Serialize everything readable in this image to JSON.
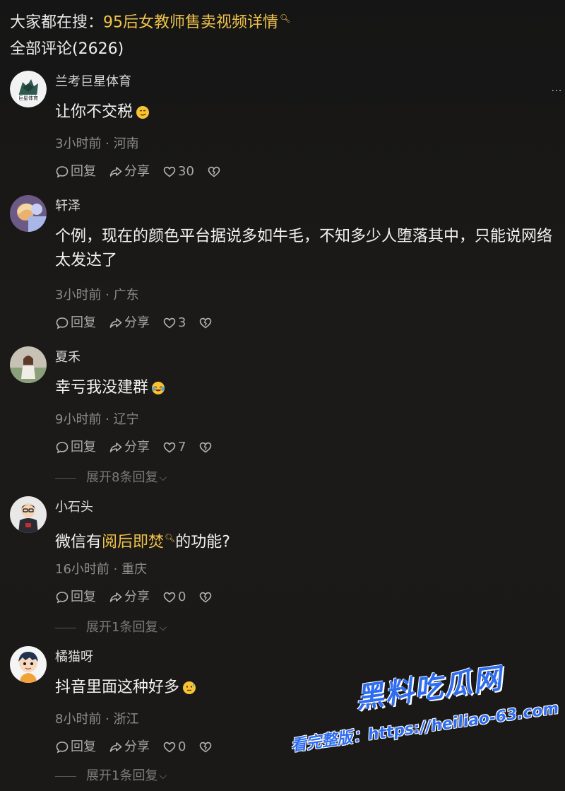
{
  "search": {
    "prefix": "大家都在搜：",
    "link_text": "95后女教师售卖视频详情",
    "icon": "search-icon"
  },
  "comments_header": {
    "label": "全部评论(2626)"
  },
  "action_labels": {
    "reply": "回复",
    "share": "分享"
  },
  "comments": [
    {
      "user": "兰考巨星体育",
      "avatar_text": "巨星体育",
      "text": "让你不交税",
      "emoji": "smirk-emoji",
      "time_location": "3小时前 · 河南",
      "likes": "30",
      "expand": ""
    },
    {
      "user": "轩泽",
      "text": "个例，现在的颜色平台据说多如牛毛，不知多少人堕落其中，只能说网络太发达了",
      "time_location": "3小时前 · 广东",
      "likes": "3",
      "expand": ""
    },
    {
      "user": "夏禾",
      "text": "幸亏我没建群",
      "emoji": "laugh-cry-emoji",
      "time_location": "9小时前 · 辽宁",
      "likes": "7",
      "expand": "展开8条回复"
    },
    {
      "user": "小石头",
      "text_before": "微信有",
      "text_link": "阅后即焚",
      "text_after": "的功能?",
      "time_location": "16小时前 · 重庆",
      "likes": "0",
      "expand": "展开1条回复"
    },
    {
      "user": "橘猫呀",
      "text": "抖音里面这种好多",
      "emoji": "awkward-emoji",
      "time_location": "8小时前 · 浙江",
      "likes": "0",
      "expand": "展开1条回复"
    }
  ],
  "watermark": {
    "title": "黑料吃瓜网",
    "url_line": "看完整版：https://heiliao-63.com"
  },
  "colors": {
    "background": "#161616",
    "highlight": "#f0c34a",
    "watermark": "#2f6df0"
  }
}
